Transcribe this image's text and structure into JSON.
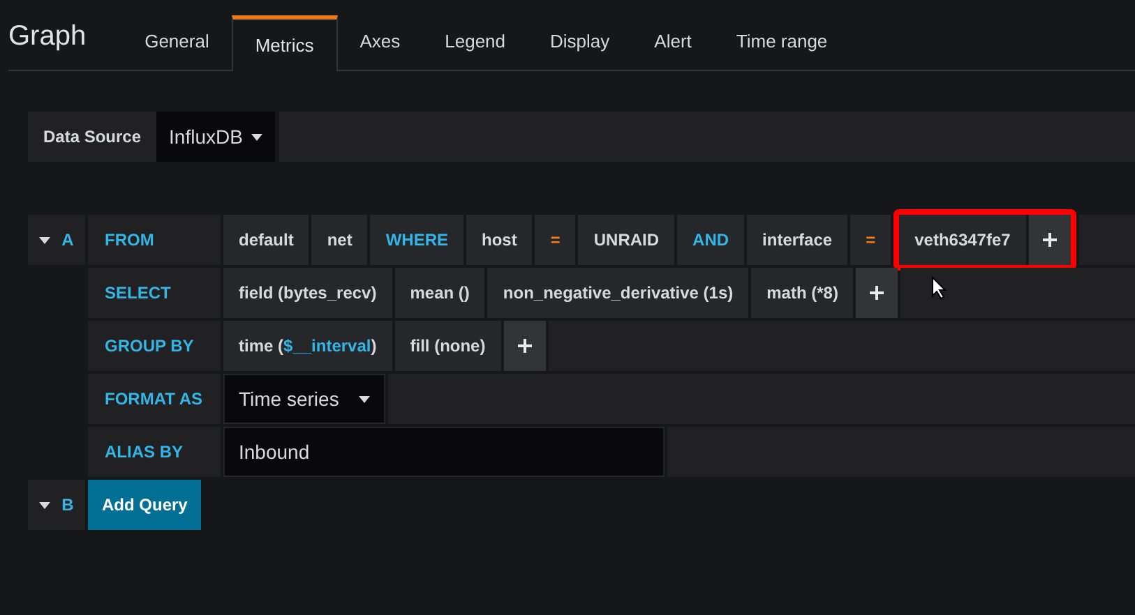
{
  "panel_title": "Graph",
  "tabs": [
    {
      "label": "General",
      "selected": false
    },
    {
      "label": "Metrics",
      "selected": true
    },
    {
      "label": "Axes",
      "selected": false
    },
    {
      "label": "Legend",
      "selected": false
    },
    {
      "label": "Display",
      "selected": false
    },
    {
      "label": "Alert",
      "selected": false
    },
    {
      "label": "Time range",
      "selected": false
    }
  ],
  "data_source": {
    "label": "Data Source",
    "value": "InfluxDB"
  },
  "queries": [
    {
      "letter": "A",
      "expanded": true,
      "rows": [
        {
          "label": "FROM",
          "segments": [
            {
              "kind": "value",
              "text": "default",
              "highlighted": false
            },
            {
              "kind": "value",
              "text": "net",
              "highlighted": false
            },
            {
              "kind": "keyword",
              "text": "WHERE",
              "highlighted": false
            },
            {
              "kind": "value",
              "text": "host",
              "highlighted": false
            },
            {
              "kind": "operator",
              "text": "=",
              "highlighted": false
            },
            {
              "kind": "value",
              "text": "UNRAID",
              "highlighted": false
            },
            {
              "kind": "keyword",
              "text": "AND",
              "highlighted": false
            },
            {
              "kind": "value",
              "text": "interface",
              "highlighted": false
            },
            {
              "kind": "operator",
              "text": "=",
              "highlighted": false
            },
            {
              "kind": "value",
              "text": "veth6347fe7",
              "highlighted": true
            },
            {
              "kind": "add",
              "highlighted": true
            }
          ]
        },
        {
          "label": "SELECT",
          "segments": [
            {
              "kind": "value",
              "text": "field (bytes_recv)",
              "highlighted": false
            },
            {
              "kind": "value",
              "text": "mean ()",
              "highlighted": false
            },
            {
              "kind": "value",
              "text": "non_negative_derivative (1s)",
              "highlighted": false
            },
            {
              "kind": "value",
              "text": "math (*8)",
              "highlighted": false
            },
            {
              "kind": "add",
              "highlighted": false
            }
          ]
        },
        {
          "label": "GROUP BY",
          "segments": [
            {
              "kind": "function",
              "parts": [
                {
                  "text": "time (",
                  "kind": "plain"
                },
                {
                  "text": "$__interval",
                  "kind": "variable"
                },
                {
                  "text": ")",
                  "kind": "plain"
                }
              ],
              "highlighted": false
            },
            {
              "kind": "value",
              "text": "fill (none)",
              "highlighted": false
            },
            {
              "kind": "add",
              "highlighted": false
            }
          ]
        },
        {
          "label": "FORMAT AS",
          "segments": [
            {
              "kind": "select",
              "text": "Time series",
              "highlighted": false
            }
          ]
        },
        {
          "label": "ALIAS BY",
          "segments": [
            {
              "kind": "input",
              "text": "Inbound",
              "highlighted": false
            }
          ]
        }
      ]
    },
    {
      "letter": "B",
      "expanded": true,
      "button": "Add Query"
    }
  ]
}
